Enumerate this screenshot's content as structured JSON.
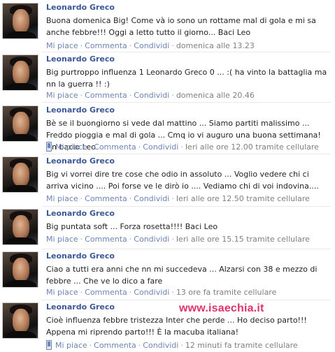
{
  "posts": [
    {
      "author": "Leonardo Greco",
      "text": "Buona domenica Big! Come và io sono un rottame mal di gola e mi sa anche febbre!!! Oggi a letto tutto il giorno... Baci Leo",
      "like": "Mi piace",
      "comment": "Commenta",
      "share": "Condividi",
      "time": "domenica alle 13.23",
      "mobile": false
    },
    {
      "author": "Leonardo Greco",
      "text": "Big purtroppo influenza 1 Leonardo Greco 0 ... :( ha vinto la battaglia ma nn la guerra !! :)",
      "like": "Mi piace",
      "comment": "Commenta",
      "share": "Condividi",
      "time": "domenica alle 20.46",
      "mobile": false
    },
    {
      "author": "Leonardo Greco",
      "text": "Bè se il buongiorno si vede dal mattino ... Siamo partiti malissimo ... Freddo pioggia e mal di gola ... Cmq io vi auguro una buona settimana! Un bacio Leo",
      "like": "Mi piace",
      "comment": "Commenta",
      "share": "Condividi",
      "time": "Ieri alle ore 12.00 tramite cellulare",
      "mobile": true
    },
    {
      "author": "Leonardo Greco",
      "text": "Big vi vorrei dire tre cose che odio in assoluto ... Voglio vedere chi ci arriva vicino .... Poi forse ve le dirò io .... Vediamo chi di voi indovina....",
      "like": "Mi piace",
      "comment": "Commenta",
      "share": "Condividi",
      "time": "Ieri alle ore 12.50 tramite cellulare",
      "mobile": false
    },
    {
      "author": "Leonardo Greco",
      "text": "Big puntata soft ... Forza rosetta!!!! Baci Leo",
      "like": "Mi piace",
      "comment": "Commenta",
      "share": "Condividi",
      "time": "Ieri alle ore 15.15 tramite cellulare",
      "mobile": false
    },
    {
      "author": "Leonardo Greco",
      "text": "Ciao a tutti era anni che nn mi succedeva ... Alzarsi con 38 e mezzo di febbre ... Che ve lo dico a fare",
      "like": "Mi piace",
      "comment": "Commenta",
      "share": "Condividi",
      "time": "13 ore fa tramite cellulare",
      "mobile": false
    },
    {
      "author": "Leonardo Greco",
      "text": "Cioè influenza febbre tristezza Inter che perde ... Ho deciso parto!!! Appena mi riprendo parto!!! È la macuba italiana!",
      "like": "Mi piace",
      "comment": "Commenta",
      "share": "Condividi",
      "time": "12 minuti fa tramite cellulare",
      "mobile": true
    }
  ],
  "watermark": "www.isaechia.it",
  "colors": {
    "link": "#3b5998",
    "action": "#6d84b4",
    "watermark": "#e0336a"
  }
}
